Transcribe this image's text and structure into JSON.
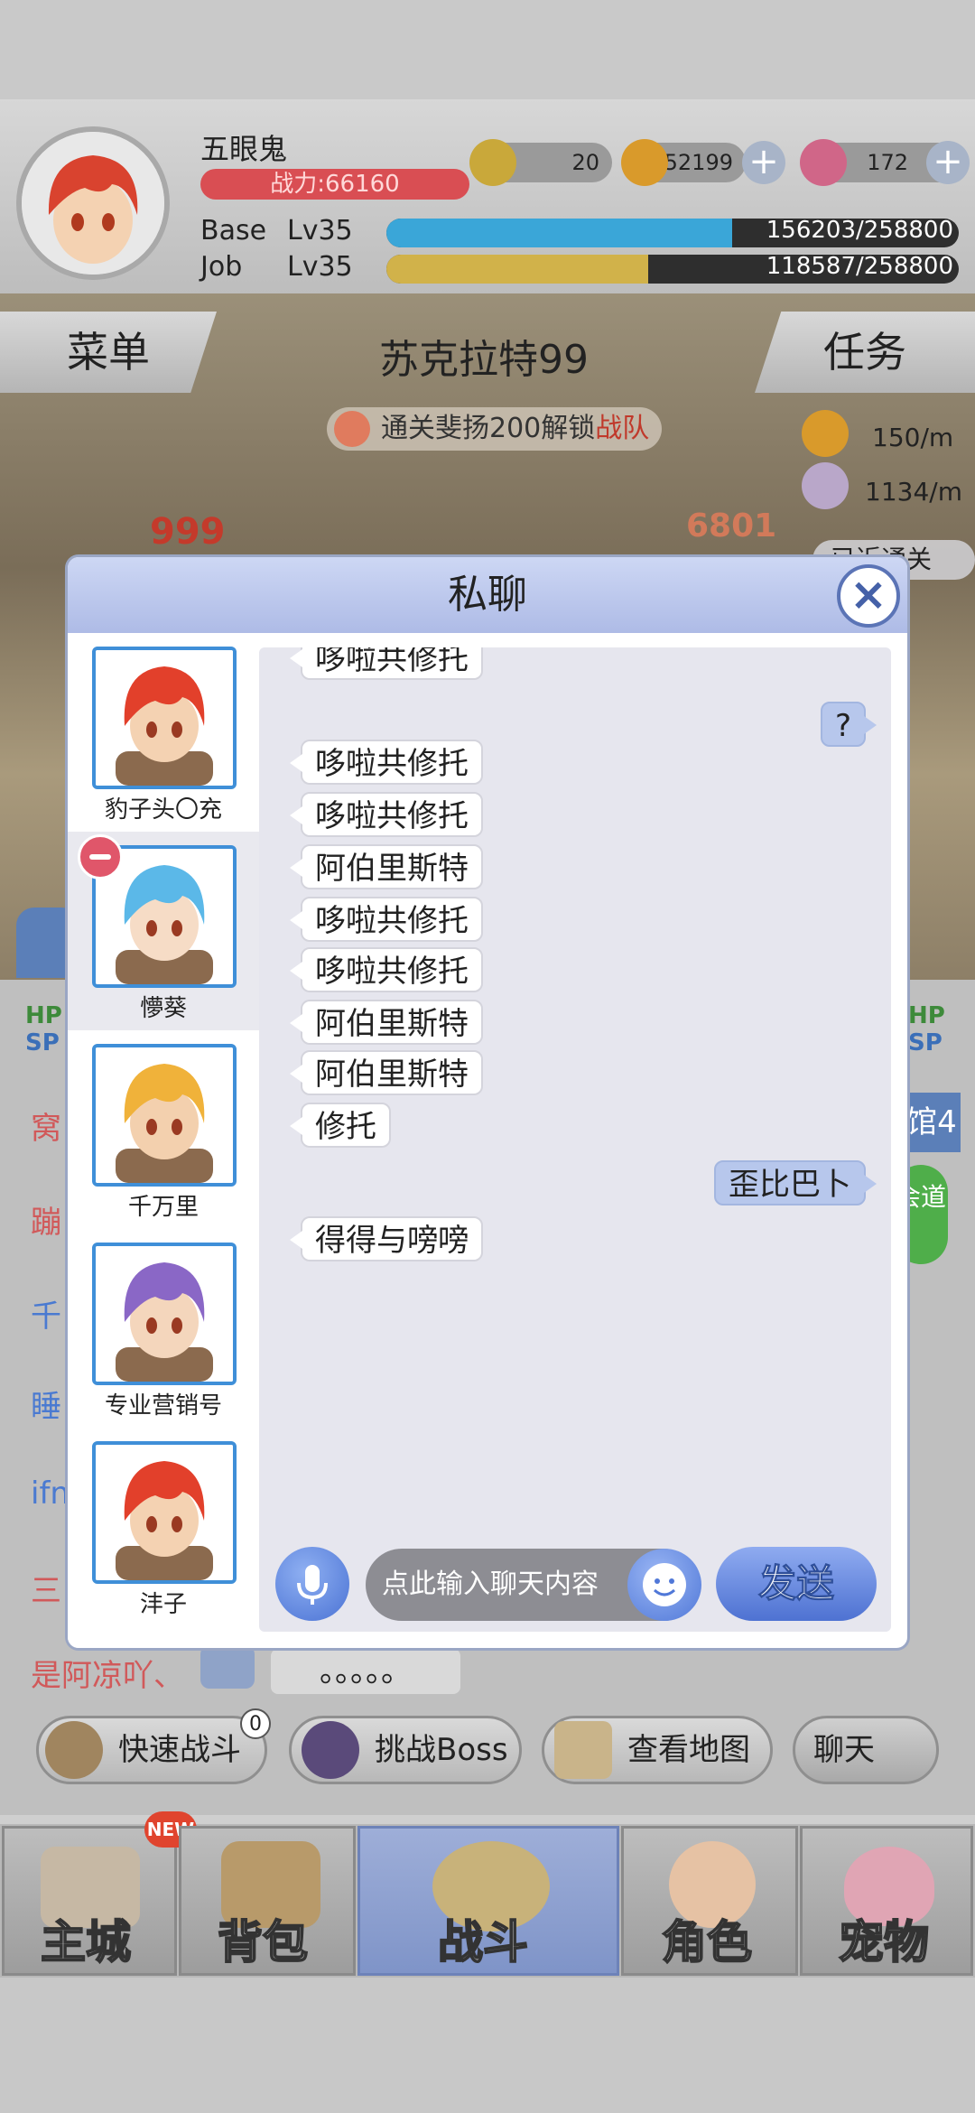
{
  "player": {
    "name": "五眼鬼",
    "power": "战力:66160",
    "zeny_small": "20",
    "zeny": "552199",
    "gems": "172",
    "base_label": "Base",
    "base_lv": "Lv35",
    "base_exp": "156203/258800",
    "base_progress": 0.6036,
    "job_label": "Job",
    "job_lv": "Lv35",
    "job_exp": "118587/258800",
    "job_progress": 0.4582
  },
  "scene": {
    "menu_label": "菜单",
    "task_label": "任务",
    "map_name": "苏克拉特99",
    "unlock_text": "通关斐扬200解锁",
    "unlock_highlight": "战队",
    "gold_rate": "150/m",
    "exp_rate": "1134/m",
    "damage_left": "999",
    "damage_right": "6801",
    "nearby_label": "已近通关"
  },
  "side_tags": {
    "hp": "HP",
    "sp": "SP",
    "right_label": "馆4",
    "guild_label": "会道"
  },
  "chat_preview": [
    {
      "text": "窝",
      "color": "#d1595a"
    },
    {
      "text": "蹦",
      "color": "#d1595a"
    },
    {
      "text": "千",
      "color": "#4a7ad1"
    },
    {
      "text": "睡",
      "color": "#4a7ad1"
    },
    {
      "text": "ifn",
      "color": "#4a7ad1"
    },
    {
      "text": "三",
      "color": "#d1595a"
    }
  ],
  "last_chat": {
    "name": "是阿凉吖、",
    "message": "。。。。。"
  },
  "quick_actions": {
    "fast_battle": "快速战斗",
    "fast_battle_count": "0",
    "boss": "挑战Boss",
    "map": "查看地图",
    "chat": "聊天"
  },
  "nav": {
    "city": "主城",
    "city_badge": "NEW",
    "bag": "背包",
    "battle": "战斗",
    "role": "角色",
    "pet": "宠物"
  },
  "dialog": {
    "title": "私聊",
    "contacts": [
      {
        "name": "豹子头〇充",
        "hair": "#e2402b",
        "skin": "#f4d2b2"
      },
      {
        "name": "懜葵",
        "hair": "#5bb8e8",
        "skin": "#f6dcc6"
      },
      {
        "name": "千万里",
        "hair": "#f0b23a",
        "skin": "#f3d0ae"
      },
      {
        "name": "专业营销号",
        "hair": "#8a67c6",
        "skin": "#f4d6bc"
      },
      {
        "name": "沣子",
        "hair": "#e2402b",
        "skin": "#f4d2b2"
      }
    ],
    "messages": [
      {
        "text": "哆啦共修托",
        "side": "in"
      },
      {
        "text": "?",
        "side": "out"
      },
      {
        "text": "哆啦共修托",
        "side": "in"
      },
      {
        "text": "哆啦共修托",
        "side": "in"
      },
      {
        "text": "阿伯里斯特",
        "side": "in"
      },
      {
        "text": "哆啦共修托",
        "side": "in"
      },
      {
        "text": "哆啦共修托",
        "side": "in"
      },
      {
        "text": "阿伯里斯特",
        "side": "in"
      },
      {
        "text": "阿伯里斯特",
        "side": "in"
      },
      {
        "text": "修托",
        "side": "in"
      },
      {
        "text": "歪比巴卜",
        "side": "out"
      },
      {
        "text": "得得与嗙嗙",
        "side": "in"
      }
    ],
    "input_placeholder": "点此输入聊天内容",
    "send_label": "发送"
  }
}
